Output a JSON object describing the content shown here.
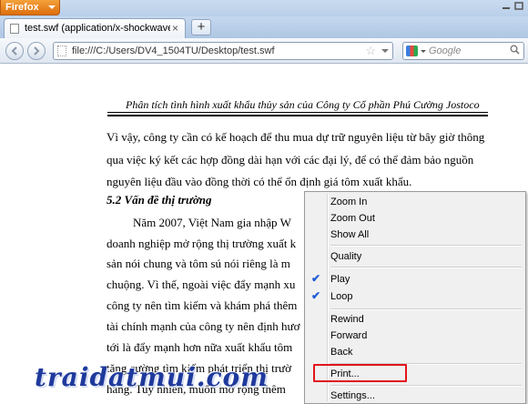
{
  "browser": {
    "menu_button_label": "Firefox",
    "tab_title": "test.swf (application/x-shockwave-flash ...",
    "tab_close_label": "×",
    "new_tab_label": "+",
    "url": "file:///C:/Users/DV4_1504TU/Desktop/test.swf",
    "search_placeholder": "Google",
    "icons": [
      "back-icon",
      "forward-icon",
      "page-icon",
      "star-icon",
      "google-icon",
      "search-icon",
      "minimize-icon",
      "maximize-icon"
    ]
  },
  "document": {
    "header": "Phân tích tình hình xuất khẩu thủy sản của Công ty Cổ phần Phú Cường Jostoco",
    "lines": [
      "Vì vậy, công ty cần có kế hoạch để thu mua dự trữ nguyên liệu từ bây giờ thông",
      "qua việc ký kết các hợp đồng dài hạn với các đại lý, để có thể đảm bảo nguồn",
      "nguyên liệu đầu vào đồng thời có thể ổn định giá tôm xuất khẩu."
    ],
    "heading": "5.2 Vấn đề thị trường",
    "para2": [
      "Năm 2007, Việt Nam gia nhập W",
      "doanh nghiệp mở rộng thị trường xuất k",
      "sản nói chung và tôm sú nói riêng là m",
      "chuộng. Vì thế, ngoài việc đẩy mạnh xu",
      "công ty nên tìm kiếm và khám phá thêm",
      "tài chính mạnh của công ty nên định hươ",
      "tới là đẩy mạnh hơn nữa xuất khẩu tôm",
      "tăng cường tìm kiếm phát triển thị trườ",
      "hàng. Tuy nhiên, muốn mở rộng thêm"
    ]
  },
  "watermark": "traidatmui.com",
  "context_menu": {
    "items": [
      {
        "label": "Zoom In"
      },
      {
        "label": "Zoom Out"
      },
      {
        "label": "Show All"
      },
      {
        "label": "Quality"
      },
      {
        "label": "Play",
        "checked": true
      },
      {
        "label": "Loop",
        "checked": true
      },
      {
        "label": "Rewind"
      },
      {
        "label": "Forward"
      },
      {
        "label": "Back"
      },
      {
        "label": "Print..."
      },
      {
        "label": "Settings..."
      }
    ],
    "check_glyph": "✔",
    "highlight_color": "#e0141c"
  }
}
